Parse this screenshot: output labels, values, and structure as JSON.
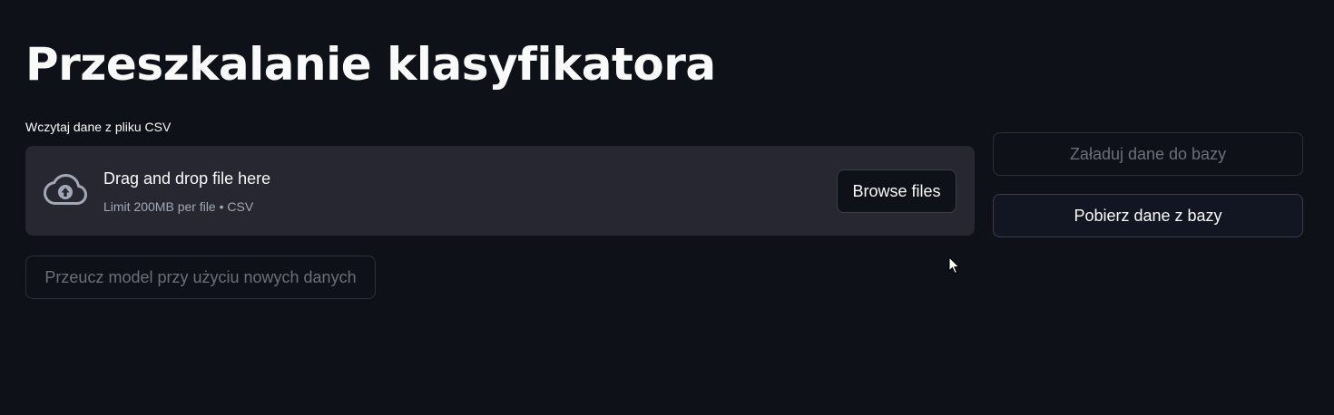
{
  "header": {
    "title": "Przeszkalanie klasyfikatora"
  },
  "uploader": {
    "label": "Wczytaj dane z pliku CSV",
    "drop_text": "Drag and drop file here",
    "limit_text": "Limit 200MB per file • CSV",
    "browse_label": "Browse files",
    "icon": "cloud-upload-icon"
  },
  "actions": {
    "load_label": "Załaduj dane do bazy",
    "load_disabled": true,
    "fetch_label": "Pobierz dane z bazy",
    "fetch_disabled": false,
    "retrain_label": "Przeucz model przy użyciu nowych danych",
    "retrain_disabled": true
  },
  "colors": {
    "background": "#0e1117",
    "dropzone": "#262730",
    "text": "#fafafa",
    "muted_text": "#a3a8b8",
    "disabled_text": "#6c6f7a"
  }
}
